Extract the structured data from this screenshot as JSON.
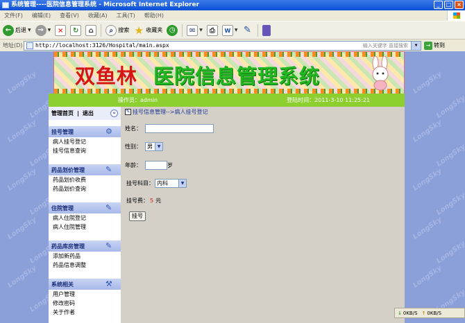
{
  "window": {
    "title": "系统管理----医院信息管理系统 - Microsoft Internet Explorer"
  },
  "menu": [
    "文件(F)",
    "编辑(E)",
    "查看(V)",
    "收藏(A)",
    "工具(T)",
    "帮助(H)"
  ],
  "toolbar": {
    "back": "后退",
    "search": "搜索",
    "favorites": "收藏夹"
  },
  "address": {
    "label": "地址(D)",
    "url": "http://localhost:3126/Hospital/main.aspx",
    "search_hint": "输入关键字 直接搜索",
    "go": "转到"
  },
  "banner": {
    "title_left": "双鱼林",
    "title_right": "医院信息管理系统"
  },
  "info": {
    "operator": "操作员：admin",
    "login_time": "登陆时间：2011-3-10 11:25:21"
  },
  "watermark": "LongSky",
  "sidebar": {
    "home": "管理首页",
    "divider": "|",
    "logout": "退出",
    "groups": [
      {
        "title": "挂号管理",
        "items": [
          "病人挂号登记",
          "挂号信息查询"
        ]
      },
      {
        "title": "药品划价管理",
        "items": [
          "药品划价收费",
          "药品划价查询"
        ]
      },
      {
        "title": "住院管理",
        "items": [
          "病人住院登记",
          "病人住院管理"
        ]
      },
      {
        "title": "药品库房管理",
        "items": [
          "添加新药品",
          "药品信息调整"
        ]
      },
      {
        "title": "系统相关",
        "items": [
          "用户管理",
          "修改密码",
          "关于作者"
        ]
      }
    ]
  },
  "form": {
    "breadcrumb": "挂号信息管理-->病人挂号登记",
    "name_label": "姓名：",
    "name_value": "",
    "sex_label": "性别：",
    "sex_value": "男",
    "age_label": "年龄：",
    "age_value": "",
    "age_unit": "岁",
    "dept_label": "挂号科目：",
    "dept_value": "内科",
    "fee_label": "挂号费：",
    "fee_value": "5",
    "fee_unit": "元",
    "submit": "挂号"
  },
  "status": {
    "down": "0KB/S",
    "up": "0KB/S"
  },
  "colors": {
    "page_bg": "#8b9fd9",
    "info_bar": "#8ccf2f",
    "content_bg": "#d4d0c8"
  }
}
